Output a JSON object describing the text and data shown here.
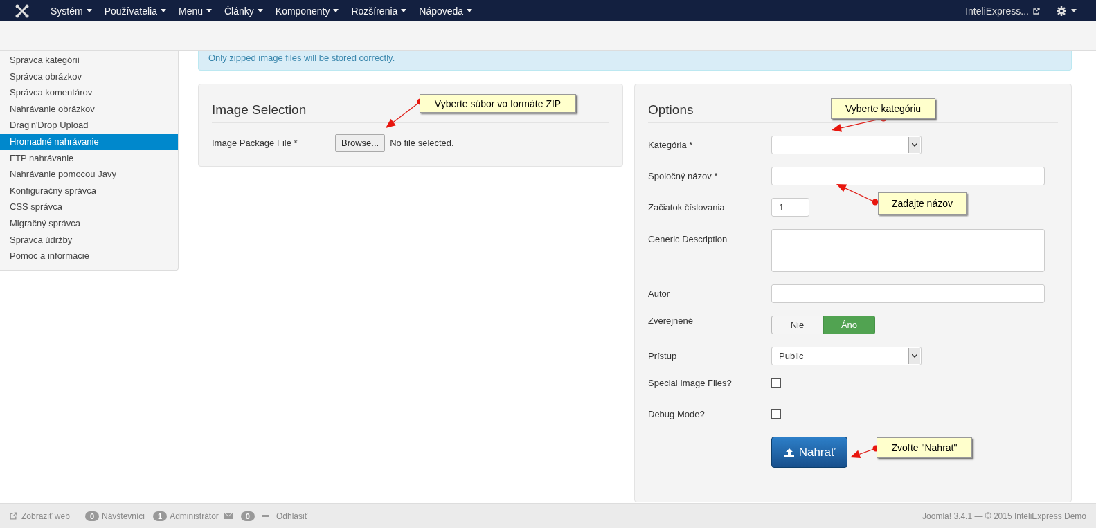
{
  "navbar": {
    "menus": [
      {
        "label": "Systém"
      },
      {
        "label": "Používatelia"
      },
      {
        "label": "Menu"
      },
      {
        "label": "Články"
      },
      {
        "label": "Komponenty"
      },
      {
        "label": "Rozšírenia"
      },
      {
        "label": "Nápoveda"
      }
    ],
    "site_link": "InteliExpress..."
  },
  "sidebar": {
    "items": [
      {
        "label": "Správca kategórií",
        "selected": false
      },
      {
        "label": "Správca obrázkov",
        "selected": false
      },
      {
        "label": "Správca komentárov",
        "selected": false
      },
      {
        "label": "Nahrávanie obrázkov",
        "selected": false
      },
      {
        "label": "Drag'n'Drop Upload",
        "selected": false
      },
      {
        "label": "Hromadné nahrávanie",
        "selected": true
      },
      {
        "label": "FTP nahrávanie",
        "selected": false
      },
      {
        "label": "Nahrávanie pomocou Javy",
        "selected": false
      },
      {
        "label": "Konfiguračný správca",
        "selected": false
      },
      {
        "label": "CSS správca",
        "selected": false
      },
      {
        "label": "Migračný správca",
        "selected": false
      },
      {
        "label": "Správca údržby",
        "selected": false
      },
      {
        "label": "Pomoc a informácie",
        "selected": false
      }
    ]
  },
  "alert": "Only zipped image files will be stored correctly.",
  "image_selection": {
    "title": "Image Selection",
    "label": "Image Package File *",
    "button": "Browse...",
    "status": "No file selected."
  },
  "options": {
    "title": "Options",
    "fields": [
      {
        "kind": "select",
        "label": "Kategória *"
      },
      {
        "kind": "text",
        "label": "Spoločný názov *"
      },
      {
        "kind": "number",
        "label": "Začiatok číslovania",
        "value": "1"
      },
      {
        "kind": "textarea",
        "label": "Generic Description"
      },
      {
        "kind": "text",
        "label": "Autor"
      },
      {
        "kind": "toggle",
        "label": "Zverejnené",
        "options": [
          {
            "label": "Nie",
            "selected": false
          },
          {
            "label": "Áno",
            "selected": true
          }
        ]
      },
      {
        "kind": "select",
        "label": "Prístup",
        "value": "Public"
      },
      {
        "kind": "checkbox",
        "label": "Special Image Files?",
        "checked": false
      },
      {
        "kind": "checkbox",
        "label": "Debug Mode?",
        "checked": false
      }
    ],
    "submit": "Nahrať"
  },
  "callouts": [
    {
      "text": "Vyberte súbor vo formáte ZIP"
    },
    {
      "text": "Vyberte kategóriu"
    },
    {
      "text": "Zadajte názov"
    },
    {
      "text": "Zvoľte \"Nahrat\""
    }
  ],
  "footer": {
    "view_site": "Zobraziť web",
    "visitors_count": "0",
    "visitors": "Návštevníci",
    "admins_count": "1",
    "admins": "Administrátor",
    "messages_count": "0",
    "logout": "Odhlásiť",
    "version": "Joomla! 3.4.1 — © 2015 InteliExpress Demo"
  }
}
